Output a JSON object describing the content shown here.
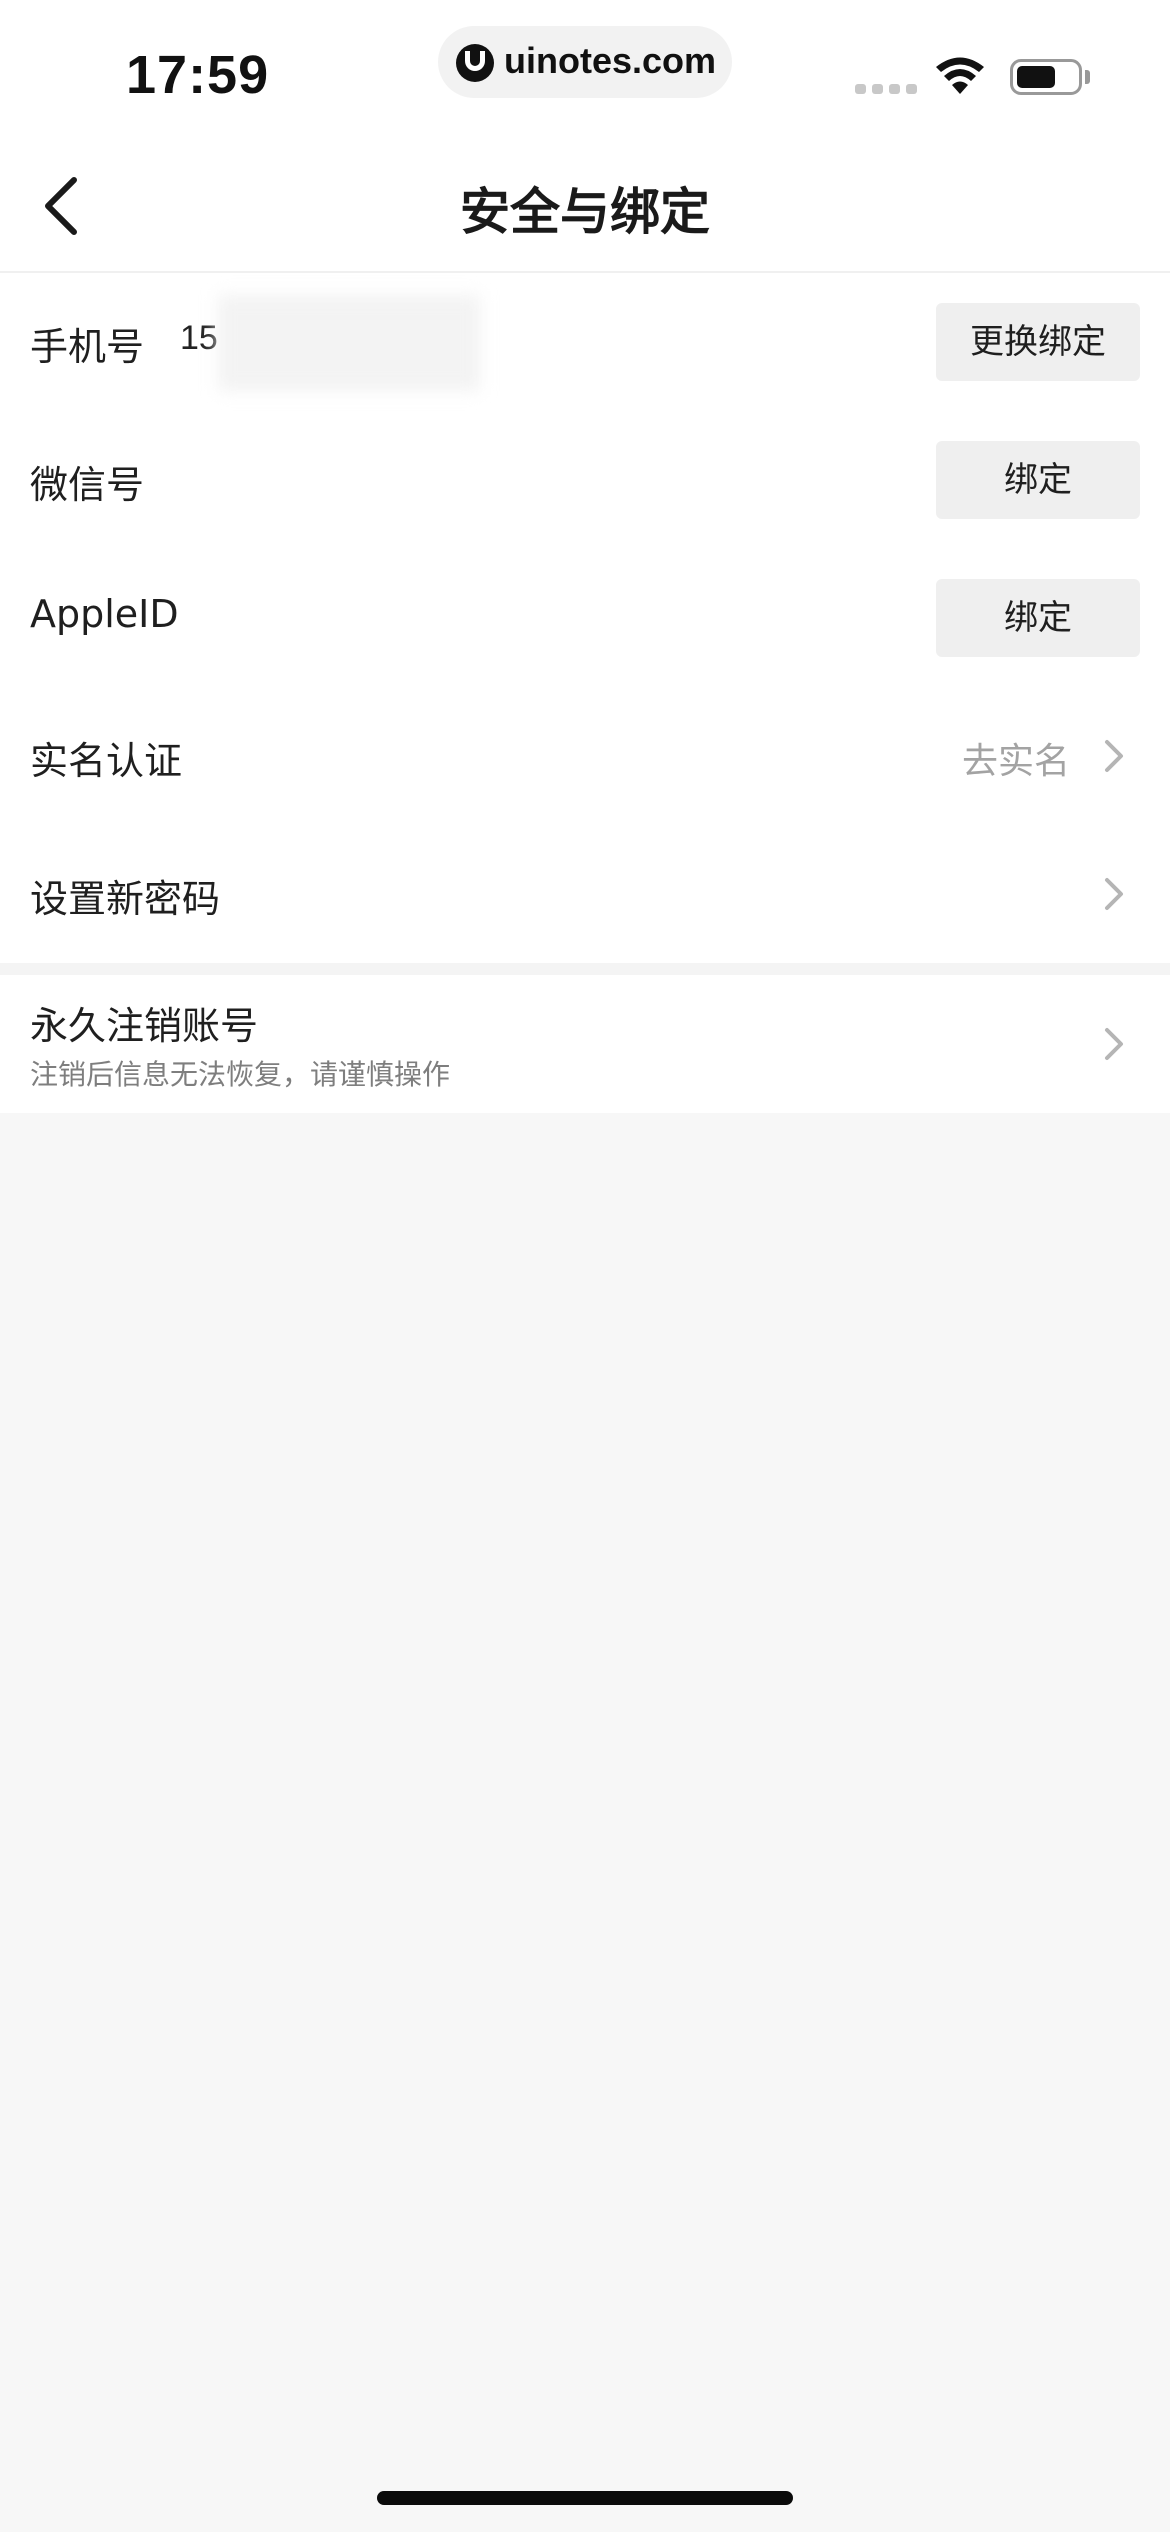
{
  "status_bar": {
    "time": "17:59",
    "url": "uinotes.com",
    "icons": [
      "cellular-signal-icon",
      "wifi-icon",
      "battery-icon"
    ]
  },
  "nav": {
    "back_icon": "chevron-left-icon",
    "title": "安全与绑定"
  },
  "list": {
    "phone": {
      "label": "手机号",
      "value": "15",
      "button": "更换绑定"
    },
    "wechat": {
      "label": "微信号",
      "button": "绑定"
    },
    "apple": {
      "label": "AppleID",
      "button": "绑定"
    },
    "realname": {
      "label": "实名认证",
      "value": "去实名",
      "icon": "chevron-right-icon"
    },
    "password": {
      "label": "设置新密码",
      "icon": "chevron-right-icon"
    }
  },
  "delete_account": {
    "title": "永久注销账号",
    "subtitle": "注销后信息无法恢复，请谨慎操作",
    "icon": "chevron-right-icon"
  },
  "colors": {
    "page_bg": "#f7f7f7",
    "card_bg": "#ffffff",
    "button_bg": "#efefef",
    "muted_text": "#a3a3a3",
    "chevron": "#b5b5b5"
  }
}
